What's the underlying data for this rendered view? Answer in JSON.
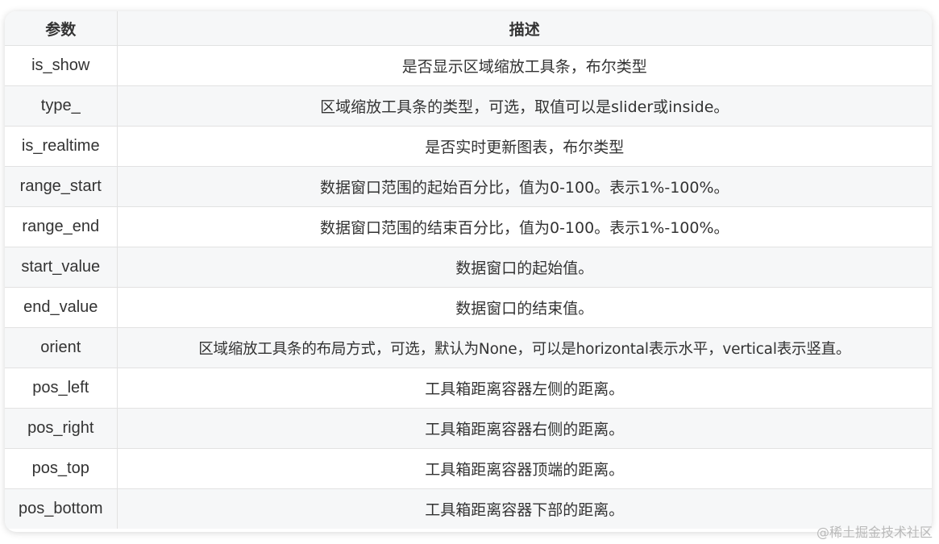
{
  "table": {
    "headers": [
      "参数",
      "描述"
    ],
    "rows": [
      {
        "param": "is_show",
        "desc": "是否显示区域缩放工具条，布尔类型"
      },
      {
        "param": "type_",
        "desc": "区域缩放工具条的类型，可选，取值可以是slider或inside。"
      },
      {
        "param": "is_realtime",
        "desc": "是否实时更新图表，布尔类型"
      },
      {
        "param": "range_start",
        "desc": "数据窗口范围的起始百分比，值为0-100。表示1%-100%。"
      },
      {
        "param": "range_end",
        "desc": "数据窗口范围的结束百分比，值为0-100。表示1%-100%。"
      },
      {
        "param": "start_value",
        "desc": "数据窗口的起始值。"
      },
      {
        "param": "end_value",
        "desc": "数据窗口的结束值。"
      },
      {
        "param": "orient",
        "desc": "区域缩放工具条的布局方式，可选，默认为None，可以是horizontal表示水平，vertical表示竖直。"
      },
      {
        "param": "pos_left",
        "desc": "工具箱距离容器左侧的距离。"
      },
      {
        "param": "pos_right",
        "desc": "工具箱距离容器右侧的距离。"
      },
      {
        "param": "pos_top",
        "desc": "工具箱距离容器顶端的距离。"
      },
      {
        "param": "pos_bottom",
        "desc": "工具箱距离容器下部的距离。"
      }
    ]
  },
  "watermark": "@稀土掘金技术社区"
}
